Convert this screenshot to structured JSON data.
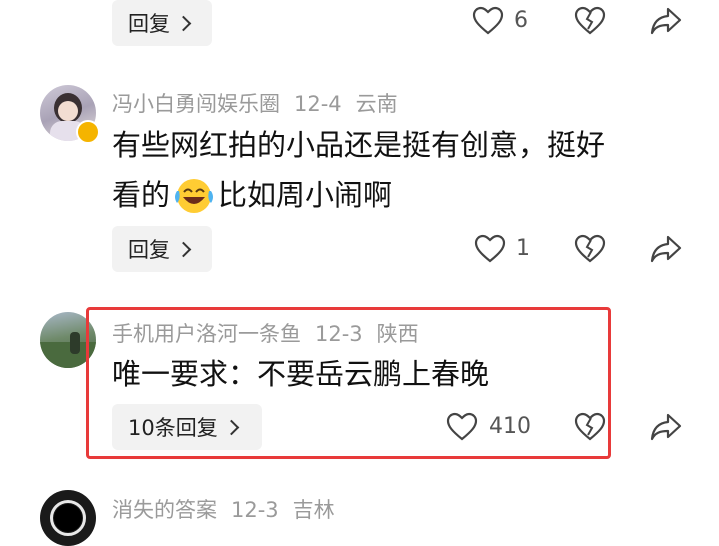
{
  "comments": [
    {
      "reply_label": "回复",
      "like_count": "6"
    },
    {
      "username": "冯小白勇闯娱乐圈",
      "date": "12-4",
      "location": "云南",
      "text_line1": "有些网红拍的小品还是挺有创意，挺好",
      "text_line2_a": "看的",
      "text_line2_b": "比如周小闹啊",
      "reply_label": "回复",
      "like_count": "1"
    },
    {
      "username": "手机用户洛河一条鱼",
      "date": "12-3",
      "location": "陕西",
      "text": "唯一要求：不要岳云鹏上春晚",
      "reply_label": "10条回复",
      "like_count": "410"
    },
    {
      "username": "消失的答案",
      "date": "12-3",
      "location": "吉林"
    }
  ],
  "colors": {
    "highlight": "#e83a3a",
    "meta": "#9a9a9a"
  }
}
